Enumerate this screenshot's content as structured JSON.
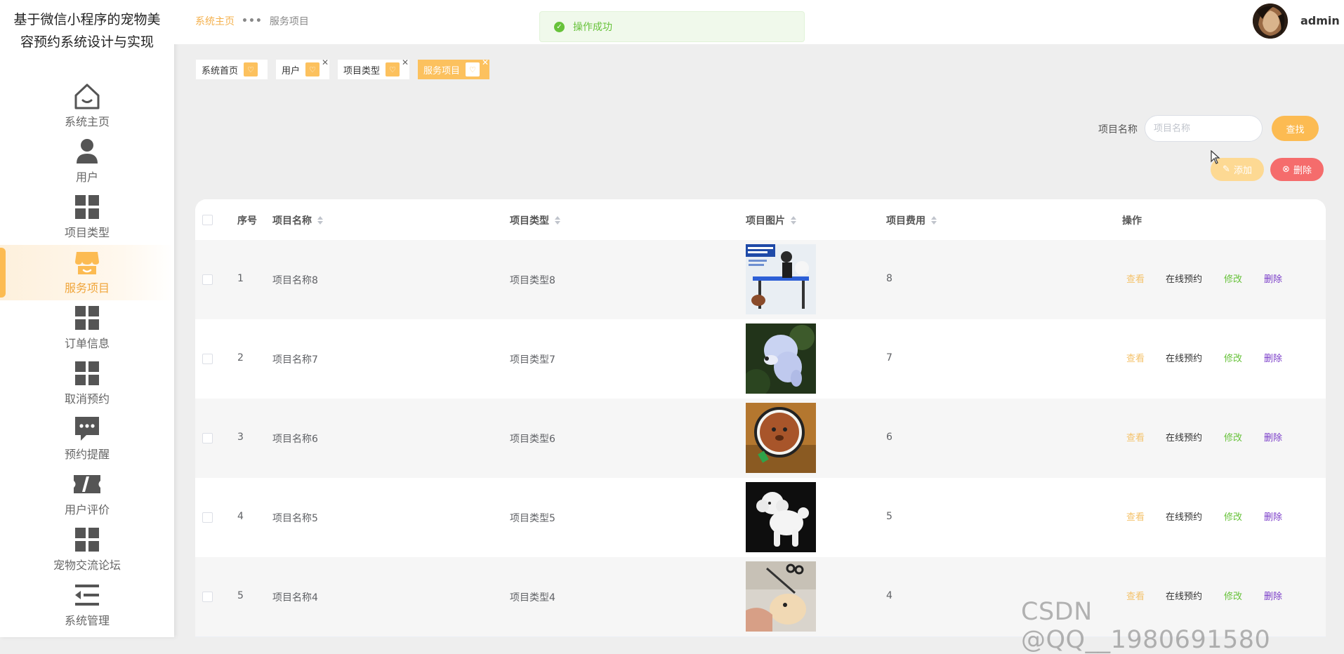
{
  "app": {
    "title": "基于微信小程序的宠物美容预约系统设计与实现"
  },
  "sidebar": {
    "items": [
      {
        "label": "系统主页",
        "icon": "home-icon"
      },
      {
        "label": "用户",
        "icon": "user-icon"
      },
      {
        "label": "项目类型",
        "icon": "grid-icon"
      },
      {
        "label": "服务项目",
        "icon": "shop-icon",
        "active": true
      },
      {
        "label": "订单信息",
        "icon": "grid-icon"
      },
      {
        "label": "取消预约",
        "icon": "grid-icon"
      },
      {
        "label": "预约提醒",
        "icon": "chat-bubble-icon"
      },
      {
        "label": "用户评价",
        "icon": "ticket-icon"
      },
      {
        "label": "宠物交流论坛",
        "icon": "grid-icon"
      },
      {
        "label": "系统管理",
        "icon": "menu-collapse-icon"
      }
    ]
  },
  "header": {
    "breadcrumb_home": "系统主页",
    "breadcrumb_sep": "•••",
    "breadcrumb_current": "服务项目",
    "toast": "操作成功",
    "username": "admin"
  },
  "tabs": [
    {
      "label": "系统首页",
      "closable": false
    },
    {
      "label": "用户",
      "closable": true
    },
    {
      "label": "项目类型",
      "closable": true
    },
    {
      "label": "服务项目",
      "closable": true,
      "active": true
    }
  ],
  "search": {
    "label": "项目名称",
    "placeholder": "项目名称",
    "value": "",
    "button": "查找"
  },
  "actions": {
    "add": "添加",
    "delete": "删除"
  },
  "table": {
    "columns": [
      "序号",
      "项目名称",
      "项目类型",
      "项目图片",
      "项目费用",
      "操作"
    ],
    "rows": [
      {
        "index": "1",
        "name": "项目名称8",
        "type": "项目类型8",
        "fee": "8",
        "image": "grooming-table-photo"
      },
      {
        "index": "2",
        "name": "项目名称7",
        "type": "项目类型7",
        "fee": "7",
        "image": "blue-poodle-photo"
      },
      {
        "index": "3",
        "name": "项目名称6",
        "type": "项目类型6",
        "fee": "6",
        "image": "brown-poodle-photo"
      },
      {
        "index": "4",
        "name": "项目名称5",
        "type": "项目类型5",
        "fee": "5",
        "image": "white-poodle-photo"
      },
      {
        "index": "5",
        "name": "项目名称4",
        "type": "项目类型4",
        "fee": "4",
        "image": "pomeranian-grooming-photo"
      }
    ],
    "ops": {
      "view": "查看",
      "book": "在线预约",
      "edit": "修改",
      "delete": "删除"
    }
  },
  "watermark": "CSDN @QQ__1980691580",
  "colors": {
    "accent": "#fcbb52",
    "danger": "#f56c6c",
    "success": "#67c23a",
    "delete_link": "#7a3cc8"
  }
}
